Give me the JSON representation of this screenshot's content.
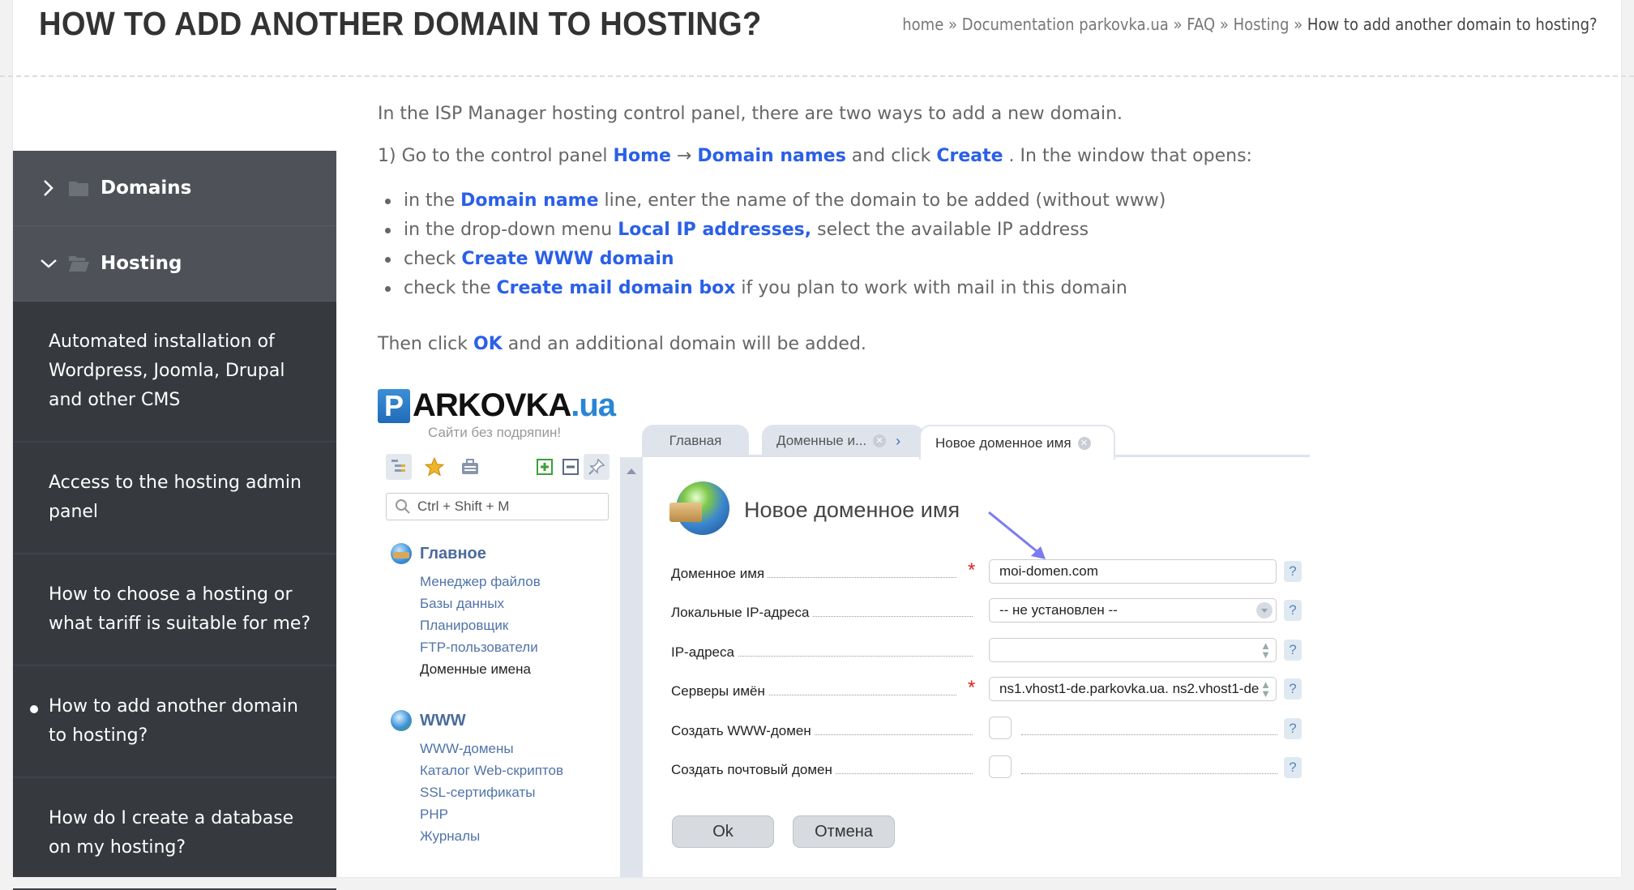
{
  "page": {
    "title": "HOW TO ADD ANOTHER DOMAIN TO HOSTING?",
    "breadcrumb": [
      {
        "label": "home"
      },
      {
        "label": "Documentation parkovka.ua"
      },
      {
        "label": "FAQ"
      },
      {
        "label": "Hosting"
      },
      {
        "label": "How to add another domain to hosting?"
      }
    ],
    "breadcrumb_separator": "»"
  },
  "sidebar": {
    "categories": [
      {
        "label": "Domains",
        "expanded": false,
        "icon": "folder-closed-icon"
      },
      {
        "label": "Hosting",
        "expanded": true,
        "icon": "folder-open-icon"
      }
    ],
    "items": [
      {
        "label": "Automated installation of Wordpress, Joomla, Drupal and other CMS",
        "active": false
      },
      {
        "label": "Access to the hosting admin panel",
        "active": false
      },
      {
        "label": "How to choose a hosting or what tariff is suitable for me?",
        "active": false
      },
      {
        "label": "How to add another domain to hosting?",
        "active": true
      },
      {
        "label": "How do I create a database on my hosting?",
        "active": false
      }
    ]
  },
  "content": {
    "intro": "In the ISP Manager hosting control panel, there are two ways to add a new domain.",
    "step1": {
      "prefix": "1) Go to the control panel ",
      "link_home": "Home",
      "arrow": " → ",
      "link_domain_names": "Domain names",
      "middle": " and click ",
      "link_create": "Create",
      "suffix": " . In the window that opens:"
    },
    "bullets": [
      {
        "before": "in the ",
        "link": "Domain name",
        "after": " line,  enter the name of the domain to be added (without www)"
      },
      {
        "before": "in the drop-down menu  ",
        "link": "Local IP addresses,",
        "after": " select the available IP address"
      },
      {
        "before": "check ",
        "link": "Create WWW domain",
        "after": ""
      },
      {
        "before": "check the ",
        "link": "Create mail domain box",
        "after": " if you plan to work with mail in this domain"
      }
    ],
    "outro": {
      "before": "Then click ",
      "link": "OK",
      "after": " and an additional domain will be added."
    },
    "link_color": "#2a5fe8"
  },
  "screenshot": {
    "logo": {
      "p": "P",
      "word": "ARKOVKA",
      "tld": ".ua",
      "slogan": "Сайти без подряпин!"
    },
    "search_placeholder": "Ctrl + Shift + M",
    "nav": [
      {
        "title": "Главное",
        "items": [
          {
            "label": "Менеджер файлов",
            "current": false
          },
          {
            "label": "Базы данных",
            "current": false
          },
          {
            "label": "Планировщик",
            "current": false
          },
          {
            "label": "FTP-пользователи",
            "current": false
          },
          {
            "label": "Доменные имена",
            "current": true
          }
        ]
      },
      {
        "title": "WWW",
        "items": [
          {
            "label": "WWW-домены",
            "current": false
          },
          {
            "label": "Каталог Web-скриптов",
            "current": false
          },
          {
            "label": "SSL-сертификаты",
            "current": false
          },
          {
            "label": "PHP",
            "current": false
          },
          {
            "label": "Журналы",
            "current": false
          }
        ]
      }
    ],
    "tabs": [
      {
        "label": "Главная",
        "closable": false,
        "active": false
      },
      {
        "label": "Доменные и...",
        "closable": true,
        "active": false
      },
      {
        "label": "Новое доменное имя",
        "closable": true,
        "active": true
      }
    ],
    "form_title": "Новое доменное имя",
    "fields": [
      {
        "label": "Доменное имя",
        "required": true,
        "type": "text",
        "value": "moi-domen.com"
      },
      {
        "label": "Локальные IP-адреса",
        "required": false,
        "type": "select",
        "value": "-- не установлен --"
      },
      {
        "label": "IP-адреса",
        "required": false,
        "type": "multiline",
        "value": ""
      },
      {
        "label": "Серверы имён",
        "required": true,
        "type": "multiline",
        "value": "ns1.vhost1-de.parkovka.ua. ns2.vhost1-de"
      },
      {
        "label": "Создать WWW-домен",
        "required": false,
        "type": "checkbox",
        "checked": false
      },
      {
        "label": "Создать почтовый домен",
        "required": false,
        "type": "checkbox",
        "checked": false
      }
    ],
    "required_mark": "*",
    "help_mark": "?",
    "ok_label": "Ok",
    "cancel_label": "Отмена"
  }
}
